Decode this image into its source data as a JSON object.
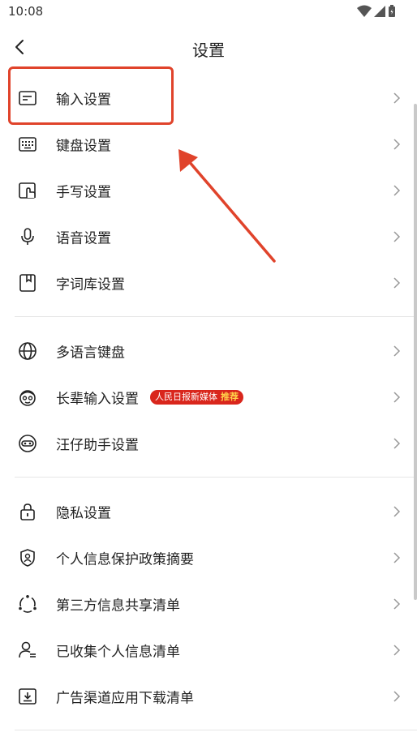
{
  "status_bar": {
    "time": "10:08"
  },
  "header": {
    "title": "设置"
  },
  "section1": [
    {
      "label": "输入设置",
      "icon": "keyboard-input-icon"
    },
    {
      "label": "键盘设置",
      "icon": "keyboard-icon"
    },
    {
      "label": "手写设置",
      "icon": "handwriting-icon"
    },
    {
      "label": "语音设置",
      "icon": "microphone-icon"
    },
    {
      "label": "字词库设置",
      "icon": "dictionary-icon"
    }
  ],
  "section2": [
    {
      "label": "多语言键盘",
      "icon": "globe-icon"
    },
    {
      "label": "长辈输入设置",
      "icon": "elder-face-icon",
      "badge_text": "人民日报新媒体",
      "badge_suffix": "推荐"
    },
    {
      "label": "汪仔助手设置",
      "icon": "mascot-icon"
    }
  ],
  "section3": [
    {
      "label": "隐私设置",
      "icon": "lock-icon"
    },
    {
      "label": "个人信息保护政策摘要",
      "icon": "shield-user-icon"
    },
    {
      "label": "第三方信息共享清单",
      "icon": "share-circle-icon"
    },
    {
      "label": "已收集个人信息清单",
      "icon": "user-list-icon"
    },
    {
      "label": "广告渠道应用下载清单",
      "icon": "download-box-icon"
    }
  ],
  "colors": {
    "annotation": "#e0432b",
    "badge": "#d9261c"
  }
}
